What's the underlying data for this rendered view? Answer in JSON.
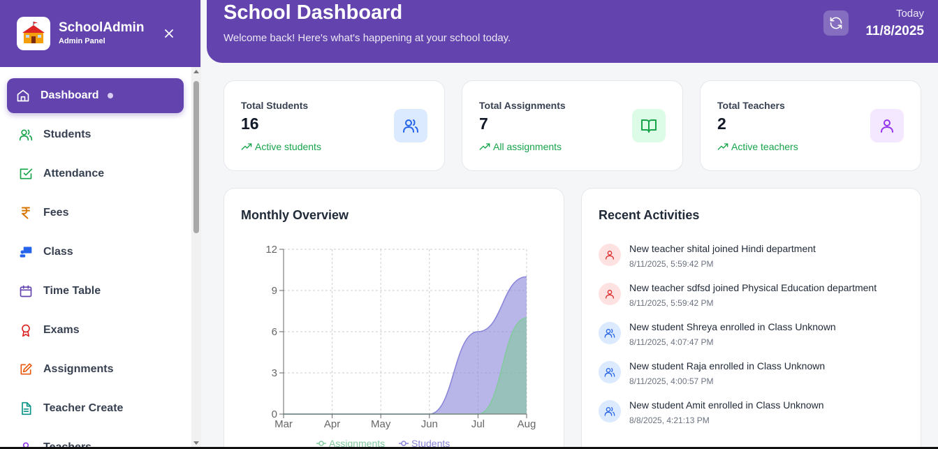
{
  "sidebar": {
    "brand_name": "SchoolAdmin",
    "brand_sub": "Admin Panel",
    "items": [
      {
        "label": "Dashboard",
        "icon": "home-icon",
        "color": "#ffffff"
      },
      {
        "label": "Students",
        "icon": "users-icon",
        "color": "#16a34a"
      },
      {
        "label": "Attendance",
        "icon": "check-square-icon",
        "color": "#16a34a"
      },
      {
        "label": "Fees",
        "icon": "rupee-icon",
        "color": "#d97706"
      },
      {
        "label": "Class",
        "icon": "presentation-icon",
        "color": "#2563eb"
      },
      {
        "label": "Time Table",
        "icon": "calendar-icon",
        "color": "#6344ae"
      },
      {
        "label": "Exams",
        "icon": "award-icon",
        "color": "#dc2626"
      },
      {
        "label": "Assignments",
        "icon": "edit-icon",
        "color": "#ea580c"
      },
      {
        "label": "Teacher Create",
        "icon": "file-text-icon",
        "color": "#0d9488"
      },
      {
        "label": "Teachers",
        "icon": "user-icon",
        "color": "#9333ea"
      }
    ]
  },
  "header": {
    "title": "School Dashboard",
    "welcome": "Welcome back! Here's what's happening at your school today.",
    "today_label": "Today",
    "today_date": "11/8/2025"
  },
  "stats": [
    {
      "label": "Total Students",
      "value": "16",
      "trend": "Active students",
      "icon": "users-icon",
      "bg": "#dbeafe",
      "fg": "#2563eb"
    },
    {
      "label": "Total Assignments",
      "value": "7",
      "trend": "All assignments",
      "icon": "book-open-icon",
      "bg": "#dcfce7",
      "fg": "#16a34a"
    },
    {
      "label": "Total Teachers",
      "value": "2",
      "trend": "Active teachers",
      "icon": "user-icon",
      "bg": "#f3e8ff",
      "fg": "#9333ea"
    }
  ],
  "overview": {
    "title": "Monthly Overview"
  },
  "chart_data": {
    "type": "area",
    "categories": [
      "Mar",
      "Apr",
      "May",
      "Jun",
      "Jul",
      "Aug"
    ],
    "series": [
      {
        "name": "Assignments",
        "values": [
          0,
          0,
          0,
          0,
          0,
          7
        ],
        "color": "#82ca9d"
      },
      {
        "name": "Students",
        "values": [
          0,
          0,
          0,
          0,
          6,
          10
        ],
        "color": "#8884d8"
      }
    ],
    "yticks": [
      "0",
      "3",
      "6",
      "9",
      "12"
    ],
    "ylim": [
      0,
      12
    ],
    "grid": true,
    "legend": "bottom"
  },
  "activities": {
    "title": "Recent Activities",
    "items": [
      {
        "text": "New teacher shital joined Hindi department",
        "time": "8/11/2025, 5:59:42 PM",
        "kind": "teacher"
      },
      {
        "text": "New teacher sdfsd joined Physical Education department",
        "time": "8/11/2025, 5:59:42 PM",
        "kind": "teacher"
      },
      {
        "text": "New student Shreya enrolled in Class Unknown",
        "time": "8/11/2025, 4:07:47 PM",
        "kind": "student"
      },
      {
        "text": "New student Raja enrolled in Class Unknown",
        "time": "8/11/2025, 4:00:57 PM",
        "kind": "student"
      },
      {
        "text": "New student Amit enrolled in Class Unknown",
        "time": "8/8/2025, 4:21:13 PM",
        "kind": "student"
      }
    ]
  }
}
